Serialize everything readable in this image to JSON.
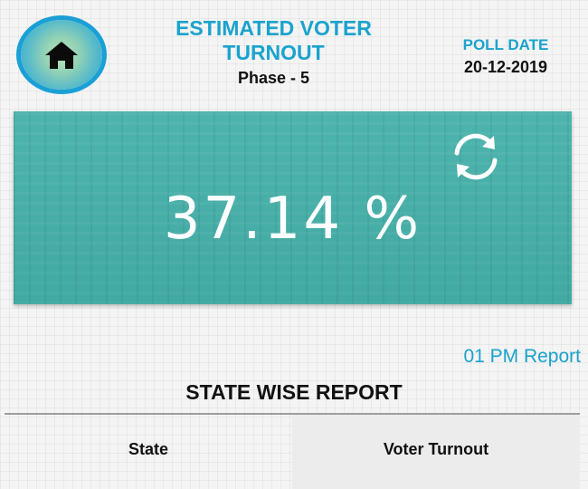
{
  "header": {
    "title": "ESTIMATED VOTER TURNOUT",
    "phase": "Phase - 5",
    "poll_date_label": "POLL DATE",
    "poll_date": "20-12-2019"
  },
  "icons": {
    "home": "home-icon",
    "refresh": "refresh-icon"
  },
  "turnout": {
    "value": "37.14 %"
  },
  "report": {
    "time": "01 PM Report",
    "section_title": "STATE WISE REPORT"
  },
  "table": {
    "columns": [
      "State",
      "Voter Turnout"
    ]
  },
  "colors": {
    "accent": "#1aa3cd",
    "card": "#44b0a9",
    "home_ring": "#1a9fd6"
  }
}
